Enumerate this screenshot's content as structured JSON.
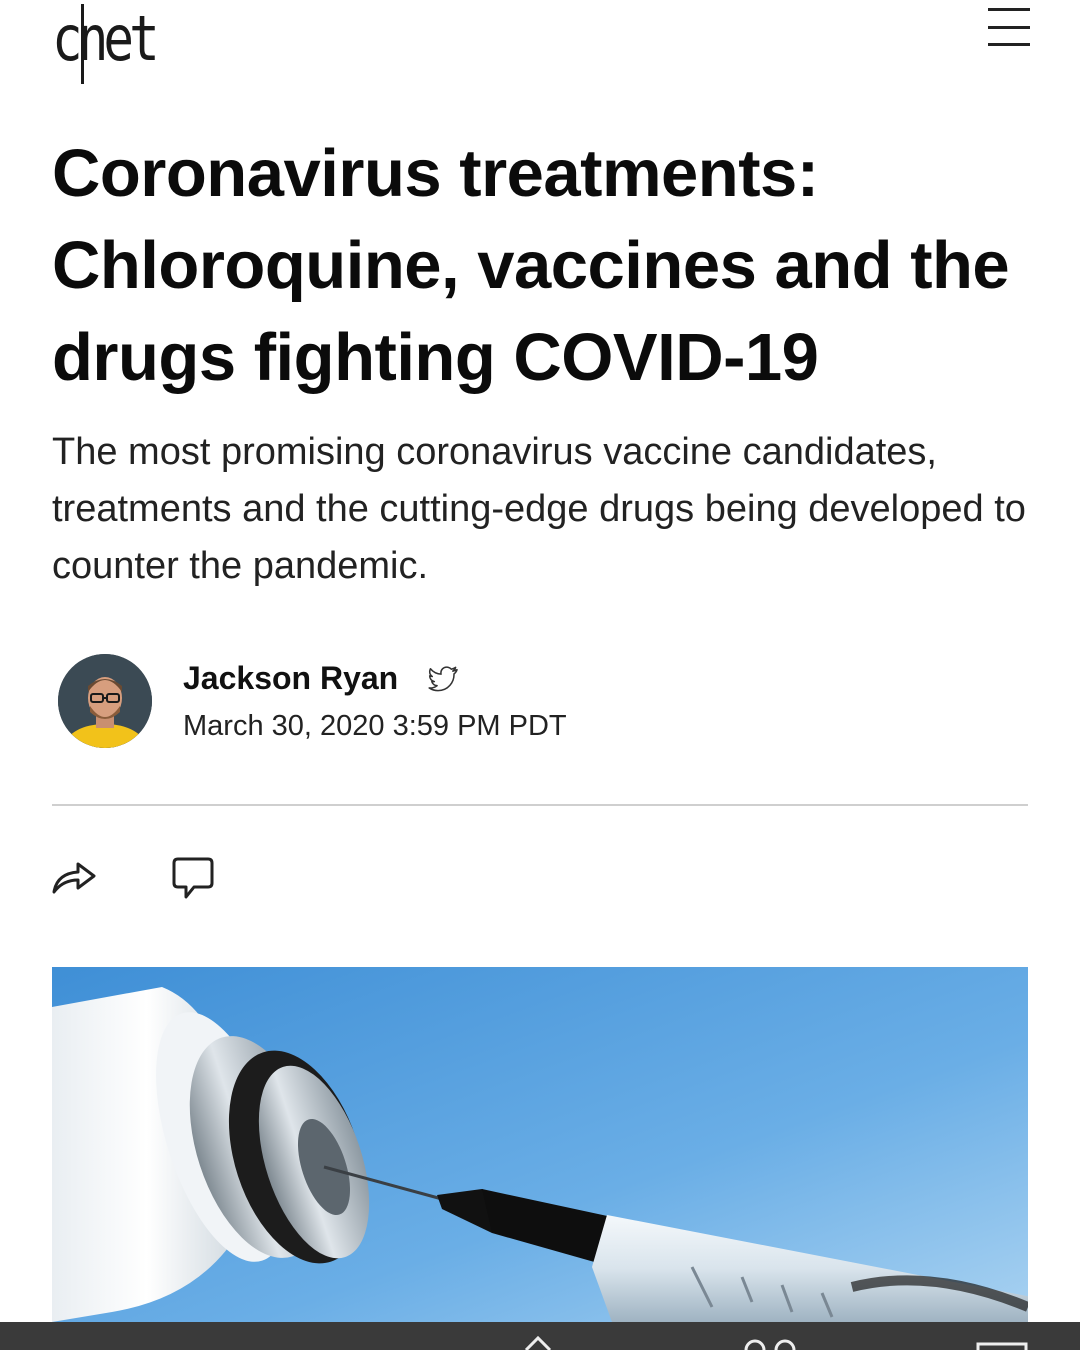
{
  "header": {
    "logo_text": "cnet",
    "menu_icon": "hamburger-menu-icon"
  },
  "article": {
    "headline": "Coronavirus treatments: Chloroquine, vaccines and the drugs fighting COVID-19",
    "subhead": "The most promising coronavirus vaccine candidates, treatments and the cutting-edge drugs being developed to counter the pandemic.",
    "author": {
      "name": "Jackson Ryan",
      "social_icon": "twitter-icon",
      "timestamp": "March 30, 2020 3:59 PM PDT"
    },
    "actions": {
      "share_icon": "share-icon",
      "comment_icon": "comment-icon"
    },
    "hero_image": "vaccine-syringe-vial-photo"
  },
  "colors": {
    "text": "#111111",
    "divider": "#cfcfcf",
    "hero_sky": "#6fb0e6",
    "bottom_bar": "#3a3a3a"
  }
}
